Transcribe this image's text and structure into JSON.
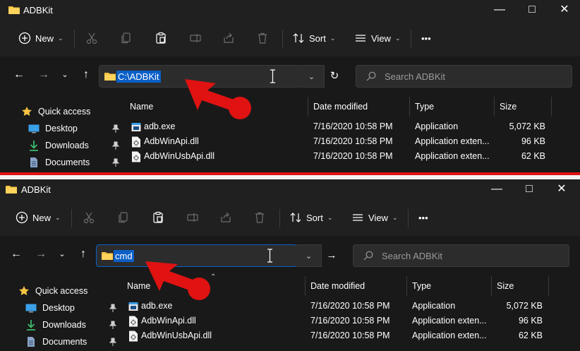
{
  "colors": {
    "accent": "#0b5fc7",
    "arrow": "#e01212",
    "folder": "#f5c242",
    "background": "#191919"
  },
  "panes": [
    {
      "window_title": "ADBKit",
      "toolbar": {
        "new_label": "New",
        "sort_label": "Sort",
        "view_label": "View",
        "more_label": "•••"
      },
      "address": {
        "value": "C:\\ADBKit",
        "action_icon": "refresh-icon"
      },
      "search": {
        "placeholder": "Search ADBKit"
      },
      "sidebar": [
        {
          "label": "Quick access",
          "icon": "star-icon"
        },
        {
          "label": "Desktop",
          "icon": "desktop-icon"
        },
        {
          "label": "Downloads",
          "icon": "download-icon"
        },
        {
          "label": "Documents",
          "icon": "documents-icon"
        }
      ],
      "columns": [
        "Name",
        "Date modified",
        "Type",
        "Size"
      ],
      "files": [
        {
          "name": "adb.exe",
          "date": "7/16/2020 10:58 PM",
          "type": "Application",
          "size": "5,072 KB",
          "icon": "exe-icon"
        },
        {
          "name": "AdbWinApi.dll",
          "date": "7/16/2020 10:58 PM",
          "type": "Application exten...",
          "size": "96 KB",
          "icon": "dll-icon"
        },
        {
          "name": "AdbWinUsbApi.dll",
          "date": "7/16/2020 10:58 PM",
          "type": "Application exten...",
          "size": "62 KB",
          "icon": "dll-icon"
        }
      ]
    },
    {
      "window_title": "ADBKit",
      "toolbar": {
        "new_label": "New",
        "sort_label": "Sort",
        "view_label": "View",
        "more_label": "•••"
      },
      "address": {
        "value": "cmd",
        "action_icon": "go-arrow-icon"
      },
      "search": {
        "placeholder": "Search ADBKit"
      },
      "sidebar": [
        {
          "label": "Quick access",
          "icon": "star-icon"
        },
        {
          "label": "Desktop",
          "icon": "desktop-icon"
        },
        {
          "label": "Downloads",
          "icon": "download-icon"
        },
        {
          "label": "Documents",
          "icon": "documents-icon"
        }
      ],
      "columns": [
        "Name",
        "Date modified",
        "Type",
        "Size"
      ],
      "files": [
        {
          "name": "adb.exe",
          "date": "7/16/2020 10:58 PM",
          "type": "Application",
          "size": "5,072 KB",
          "icon": "exe-icon"
        },
        {
          "name": "AdbWinApi.dll",
          "date": "7/16/2020 10:58 PM",
          "type": "Application exten...",
          "size": "96 KB",
          "icon": "dll-icon"
        },
        {
          "name": "AdbWinUsbApi.dll",
          "date": "7/16/2020 10:58 PM",
          "type": "Application exten...",
          "size": "62 KB",
          "icon": "dll-icon"
        }
      ]
    }
  ]
}
